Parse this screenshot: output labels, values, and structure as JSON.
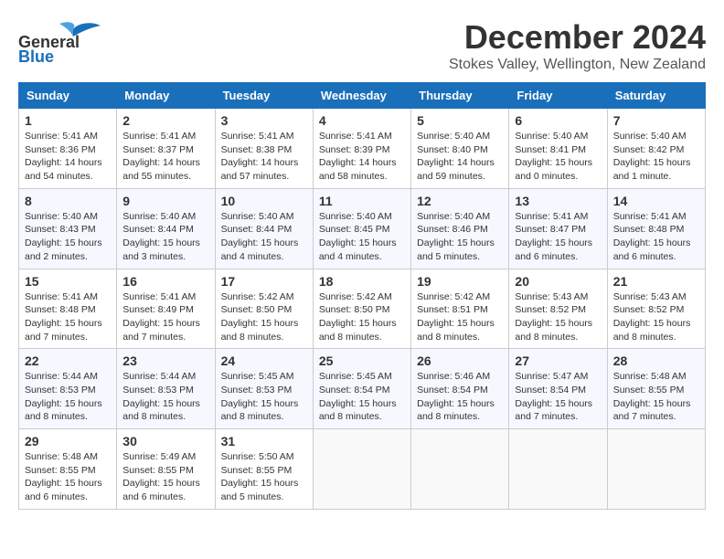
{
  "header": {
    "logo_line1": "General",
    "logo_line2": "Blue",
    "month_title": "December 2024",
    "location": "Stokes Valley, Wellington, New Zealand"
  },
  "weekdays": [
    "Sunday",
    "Monday",
    "Tuesday",
    "Wednesday",
    "Thursday",
    "Friday",
    "Saturday"
  ],
  "weeks": [
    [
      {
        "day": "1",
        "info": "Sunrise: 5:41 AM\nSunset: 8:36 PM\nDaylight: 14 hours\nand 54 minutes."
      },
      {
        "day": "2",
        "info": "Sunrise: 5:41 AM\nSunset: 8:37 PM\nDaylight: 14 hours\nand 55 minutes."
      },
      {
        "day": "3",
        "info": "Sunrise: 5:41 AM\nSunset: 8:38 PM\nDaylight: 14 hours\nand 57 minutes."
      },
      {
        "day": "4",
        "info": "Sunrise: 5:41 AM\nSunset: 8:39 PM\nDaylight: 14 hours\nand 58 minutes."
      },
      {
        "day": "5",
        "info": "Sunrise: 5:40 AM\nSunset: 8:40 PM\nDaylight: 14 hours\nand 59 minutes."
      },
      {
        "day": "6",
        "info": "Sunrise: 5:40 AM\nSunset: 8:41 PM\nDaylight: 15 hours\nand 0 minutes."
      },
      {
        "day": "7",
        "info": "Sunrise: 5:40 AM\nSunset: 8:42 PM\nDaylight: 15 hours\nand 1 minute."
      }
    ],
    [
      {
        "day": "8",
        "info": "Sunrise: 5:40 AM\nSunset: 8:43 PM\nDaylight: 15 hours\nand 2 minutes."
      },
      {
        "day": "9",
        "info": "Sunrise: 5:40 AM\nSunset: 8:44 PM\nDaylight: 15 hours\nand 3 minutes."
      },
      {
        "day": "10",
        "info": "Sunrise: 5:40 AM\nSunset: 8:44 PM\nDaylight: 15 hours\nand 4 minutes."
      },
      {
        "day": "11",
        "info": "Sunrise: 5:40 AM\nSunset: 8:45 PM\nDaylight: 15 hours\nand 4 minutes."
      },
      {
        "day": "12",
        "info": "Sunrise: 5:40 AM\nSunset: 8:46 PM\nDaylight: 15 hours\nand 5 minutes."
      },
      {
        "day": "13",
        "info": "Sunrise: 5:41 AM\nSunset: 8:47 PM\nDaylight: 15 hours\nand 6 minutes."
      },
      {
        "day": "14",
        "info": "Sunrise: 5:41 AM\nSunset: 8:48 PM\nDaylight: 15 hours\nand 6 minutes."
      }
    ],
    [
      {
        "day": "15",
        "info": "Sunrise: 5:41 AM\nSunset: 8:48 PM\nDaylight: 15 hours\nand 7 minutes."
      },
      {
        "day": "16",
        "info": "Sunrise: 5:41 AM\nSunset: 8:49 PM\nDaylight: 15 hours\nand 7 minutes."
      },
      {
        "day": "17",
        "info": "Sunrise: 5:42 AM\nSunset: 8:50 PM\nDaylight: 15 hours\nand 8 minutes."
      },
      {
        "day": "18",
        "info": "Sunrise: 5:42 AM\nSunset: 8:50 PM\nDaylight: 15 hours\nand 8 minutes."
      },
      {
        "day": "19",
        "info": "Sunrise: 5:42 AM\nSunset: 8:51 PM\nDaylight: 15 hours\nand 8 minutes."
      },
      {
        "day": "20",
        "info": "Sunrise: 5:43 AM\nSunset: 8:52 PM\nDaylight: 15 hours\nand 8 minutes."
      },
      {
        "day": "21",
        "info": "Sunrise: 5:43 AM\nSunset: 8:52 PM\nDaylight: 15 hours\nand 8 minutes."
      }
    ],
    [
      {
        "day": "22",
        "info": "Sunrise: 5:44 AM\nSunset: 8:53 PM\nDaylight: 15 hours\nand 8 minutes."
      },
      {
        "day": "23",
        "info": "Sunrise: 5:44 AM\nSunset: 8:53 PM\nDaylight: 15 hours\nand 8 minutes."
      },
      {
        "day": "24",
        "info": "Sunrise: 5:45 AM\nSunset: 8:53 PM\nDaylight: 15 hours\nand 8 minutes."
      },
      {
        "day": "25",
        "info": "Sunrise: 5:45 AM\nSunset: 8:54 PM\nDaylight: 15 hours\nand 8 minutes."
      },
      {
        "day": "26",
        "info": "Sunrise: 5:46 AM\nSunset: 8:54 PM\nDaylight: 15 hours\nand 8 minutes."
      },
      {
        "day": "27",
        "info": "Sunrise: 5:47 AM\nSunset: 8:54 PM\nDaylight: 15 hours\nand 7 minutes."
      },
      {
        "day": "28",
        "info": "Sunrise: 5:48 AM\nSunset: 8:55 PM\nDaylight: 15 hours\nand 7 minutes."
      }
    ],
    [
      {
        "day": "29",
        "info": "Sunrise: 5:48 AM\nSunset: 8:55 PM\nDaylight: 15 hours\nand 6 minutes."
      },
      {
        "day": "30",
        "info": "Sunrise: 5:49 AM\nSunset: 8:55 PM\nDaylight: 15 hours\nand 6 minutes."
      },
      {
        "day": "31",
        "info": "Sunrise: 5:50 AM\nSunset: 8:55 PM\nDaylight: 15 hours\nand 5 minutes."
      },
      {
        "day": "",
        "info": ""
      },
      {
        "day": "",
        "info": ""
      },
      {
        "day": "",
        "info": ""
      },
      {
        "day": "",
        "info": ""
      }
    ]
  ]
}
